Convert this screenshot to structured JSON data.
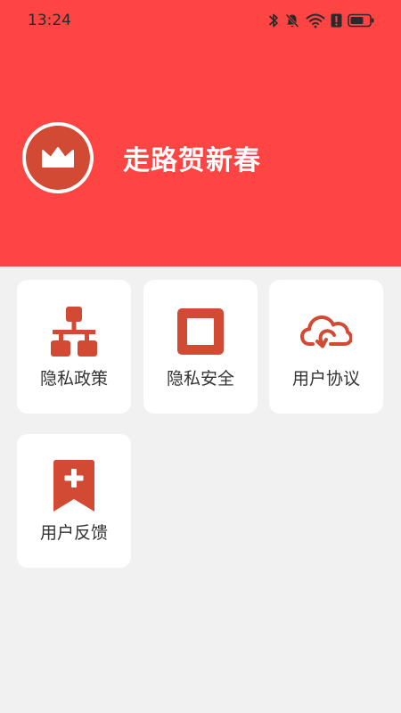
{
  "status_bar": {
    "time": "13:24",
    "icons": [
      "bluetooth-icon",
      "bell-muted-icon",
      "wifi-icon",
      "alert-icon",
      "battery-icon"
    ]
  },
  "header": {
    "app_title": "走路贺新春",
    "avatar_icon": "crown-icon",
    "background_color": "#ff4444"
  },
  "menu": {
    "items": [
      {
        "label": "隐私政策",
        "icon": "network-hierarchy-icon"
      },
      {
        "label": "隐私安全",
        "icon": "square-frame-icon"
      },
      {
        "label": "用户协议",
        "icon": "cloud-sync-icon"
      },
      {
        "label": "用户反馈",
        "icon": "bookmark-plus-icon"
      }
    ],
    "icon_color": "#d24a33"
  }
}
